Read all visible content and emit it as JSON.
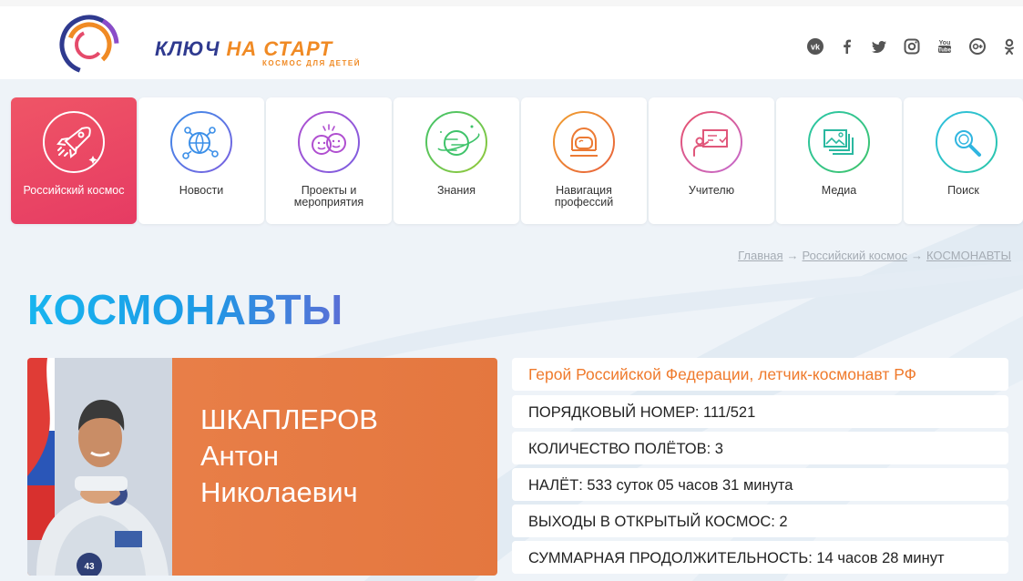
{
  "bookmarks": [
    "",
    "",
    "",
    "",
    "",
    "",
    "",
    ""
  ],
  "logo": {
    "title_part1": "КЛЮЧ",
    "title_part2": "НА СТАРТ",
    "subtitle": "КОСМОС ДЛЯ ДЕТЕЙ"
  },
  "social_icons": [
    "vk-icon",
    "facebook-icon",
    "twitter-icon",
    "instagram-icon",
    "youtube-icon",
    "odnoklassniki-circle-icon",
    "odnoklassniki-icon"
  ],
  "nav": {
    "items": [
      {
        "label": "Российский космос",
        "icon": "rocket-icon",
        "active": true
      },
      {
        "label": "Новости",
        "icon": "globe-network-icon",
        "active": false
      },
      {
        "label": "Проекты и мероприятия",
        "icon": "faces-icon",
        "active": false
      },
      {
        "label": "Знания",
        "icon": "planet-icon",
        "active": false
      },
      {
        "label": "Навигация профессий",
        "icon": "astronaut-helmet-icon",
        "active": false
      },
      {
        "label": "Учителю",
        "icon": "teacher-board-icon",
        "active": false
      },
      {
        "label": "Медиа",
        "icon": "photo-gallery-icon",
        "active": false
      },
      {
        "label": "Поиск",
        "icon": "search-icon",
        "active": false
      }
    ]
  },
  "breadcrumb": {
    "home": "Главная",
    "section": "Российский космос",
    "current": "КОСМОНАВТЫ",
    "separator": "→"
  },
  "page": {
    "title": "КОСМОНАВТЫ"
  },
  "cosmonaut": {
    "last_name": "ШКАПЛЕРОВ",
    "first_name": "Антон",
    "patronymic": "Николаевич",
    "title": "Герой Российской Федерации, летчик-космонавт РФ",
    "facts": [
      "ПОРЯДКОВЫЙ НОМЕР: 111/521",
      "КОЛИЧЕСТВО ПОЛЁТОВ: 3",
      "НАЛЁТ: 533 суток 05 часов 31 минута",
      "ВЫХОДЫ В ОТКРЫТЫЙ КОСМОС: 2",
      "СУММАРНАЯ ПРОДОЛЖИТЕЛЬНОСТЬ:  14 часов  28 минут"
    ]
  },
  "colors": {
    "accent_orange": "#e87d47",
    "active_tile": "#e9455f",
    "title_blue": "#1aa7ea"
  }
}
